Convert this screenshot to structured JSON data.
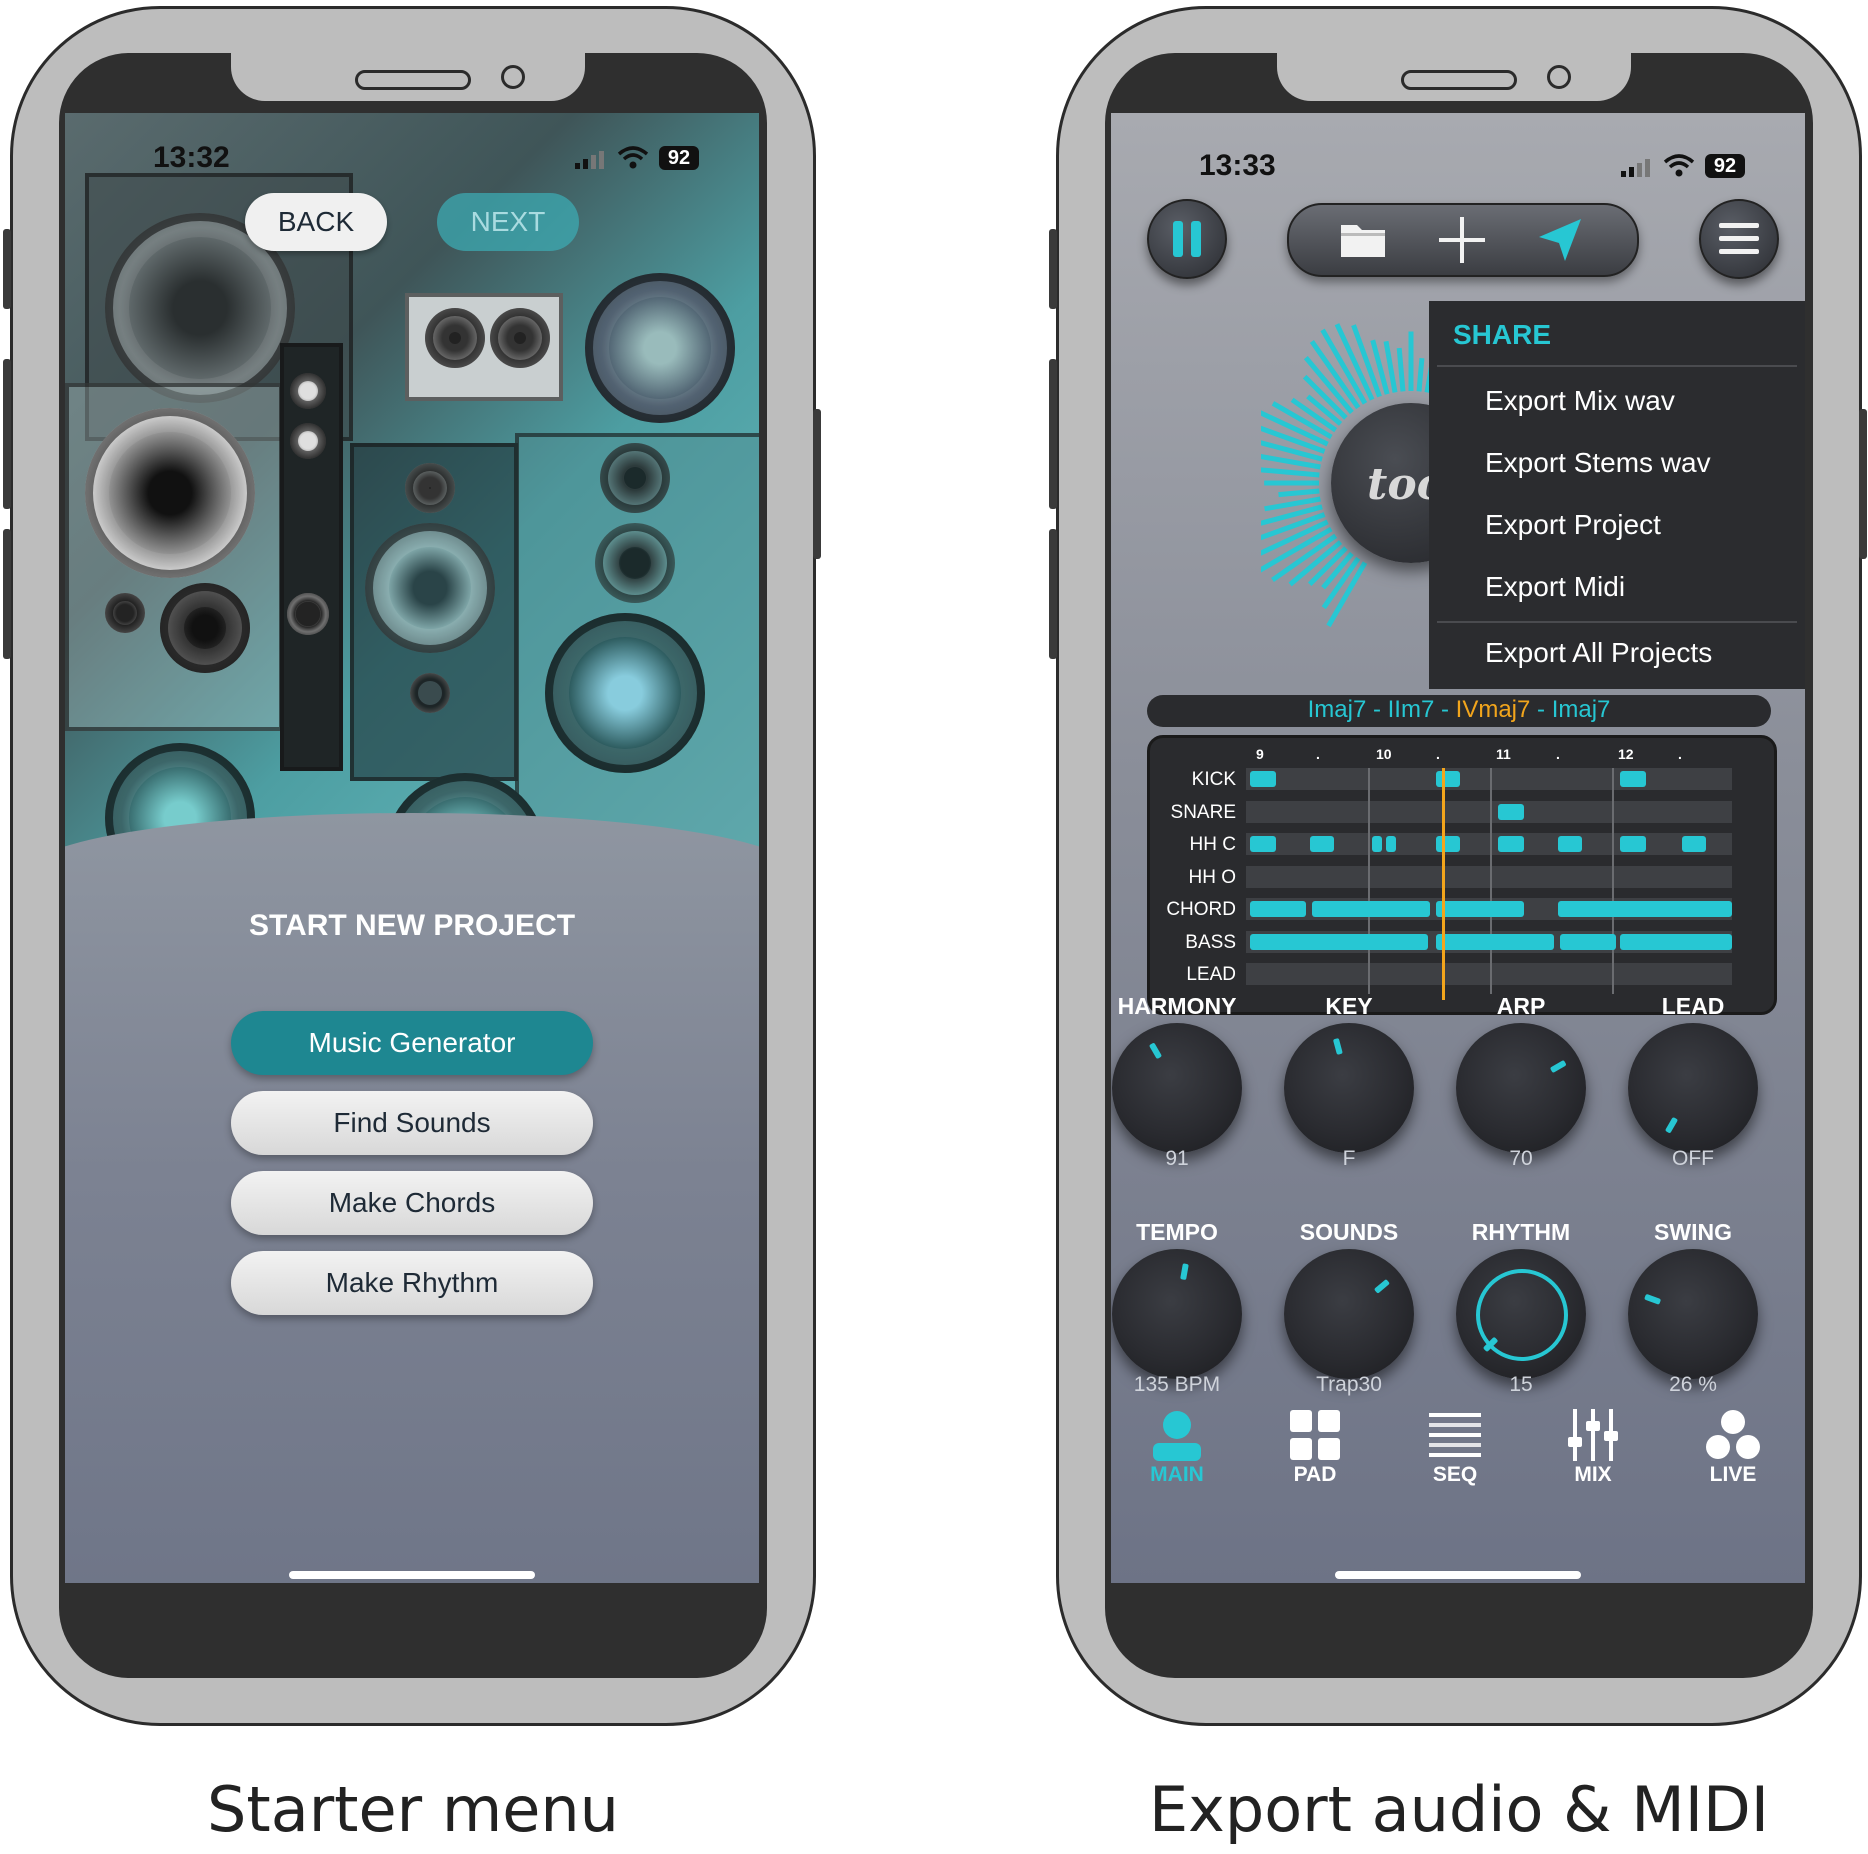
{
  "captions": {
    "left": "Starter menu",
    "right": "Export audio & MIDI"
  },
  "left_phone": {
    "status": {
      "time": "13:32",
      "battery": "92"
    },
    "nav": {
      "back": "BACK",
      "next": "NEXT"
    },
    "title": "START NEW PROJECT",
    "options": [
      {
        "label": "Music Generator",
        "active": true
      },
      {
        "label": "Find Sounds",
        "active": false
      },
      {
        "label": "Make Chords",
        "active": false
      },
      {
        "label": "Make Rhythm",
        "active": false
      }
    ]
  },
  "right_phone": {
    "status": {
      "time": "13:33",
      "battery": "92"
    },
    "logo": "toool",
    "share_menu": {
      "title": "SHARE",
      "items": [
        "Export Mix wav",
        "Export Stems wav",
        "Export Project",
        "Export Midi",
        "Export All Projects"
      ]
    },
    "chord_progression": [
      {
        "text": "Imaj7",
        "color": "#27c7d3"
      },
      {
        "text": " - ",
        "color": "#27c7d3"
      },
      {
        "text": "IIm7",
        "color": "#27c7d3"
      },
      {
        "text": " - ",
        "color": "#27c7d3"
      },
      {
        "text": "IVmaj7",
        "color": "#f2a51c"
      },
      {
        "text": " - ",
        "color": "#27c7d3"
      },
      {
        "text": "Imaj7",
        "color": "#27c7d3"
      }
    ],
    "sequencer": {
      "beat_markers": [
        "9",
        ".",
        "10",
        ".",
        "11",
        ".",
        "12",
        "."
      ],
      "tracks": [
        "KICK",
        "SNARE",
        "HH C",
        "HH O",
        "CHORD",
        "BASS",
        "LEAD"
      ]
    },
    "knobs_row1": [
      {
        "label": "HARMONY",
        "value": "91",
        "angle": -30
      },
      {
        "label": "KEY",
        "value": "F",
        "angle": -15
      },
      {
        "label": "ARP",
        "value": "70",
        "angle": 60
      },
      {
        "label": "LEAD",
        "value": "OFF",
        "angle": -150
      }
    ],
    "knobs_row2": [
      {
        "label": "TEMPO",
        "value": "135 BPM",
        "angle": 10
      },
      {
        "label": "SOUNDS",
        "value": "Trap30",
        "angle": 50
      },
      {
        "label": "RHYTHM",
        "value": "15",
        "angle": -135
      },
      {
        "label": "SWING",
        "value": "26 %",
        "angle": -70
      }
    ],
    "bottom_nav": [
      {
        "label": "MAIN",
        "icon": "person-icon",
        "active": true
      },
      {
        "label": "PAD",
        "icon": "grid-icon",
        "active": false
      },
      {
        "label": "SEQ",
        "icon": "sequencer-icon",
        "active": false
      },
      {
        "label": "MIX",
        "icon": "mixer-icon",
        "active": false
      },
      {
        "label": "LIVE",
        "icon": "live-icon",
        "active": false
      }
    ],
    "accent_color": "#27c7d3"
  }
}
